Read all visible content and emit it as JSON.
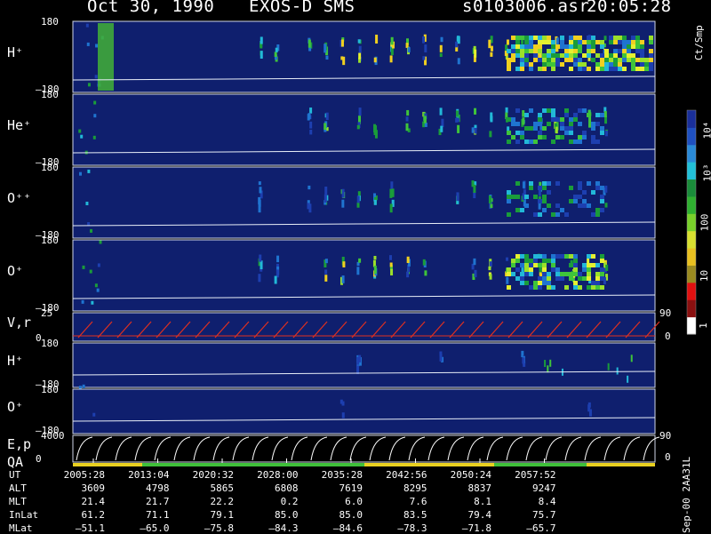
{
  "header": {
    "date": "Oct 30, 1990",
    "instrument": "EXOS-D SMS",
    "file": "s0103006.asr",
    "time": "20:05:28"
  },
  "colorbar": {
    "unit": "Ct/Smp",
    "ticks": [
      "10⁴",
      "10³",
      "100",
      "10",
      "1"
    ]
  },
  "panels": [
    {
      "label": "H⁺",
      "top": "180",
      "bottom": "–180"
    },
    {
      "label": "He⁺",
      "top": "180",
      "bottom": "–180"
    },
    {
      "label": "O⁺⁺",
      "top": "180",
      "bottom": "–180"
    },
    {
      "label": "O⁺",
      "top": "180",
      "bottom": "–180"
    },
    {
      "label": "V,r",
      "top": "25",
      "bottom": "0",
      "right_top": "90",
      "right_bottom": "0"
    },
    {
      "label": "H⁺",
      "top": "180",
      "bottom": "–180"
    },
    {
      "label": "O⁺",
      "top": "180",
      "bottom": "–180"
    },
    {
      "label": "E,p",
      "label2": "QA",
      "top": "4000",
      "bottom": "0",
      "right_top": "90",
      "right_bottom": "0"
    }
  ],
  "table": {
    "row_labels": [
      "UT",
      "ALT",
      "MLT",
      "InLat",
      "MLat"
    ],
    "columns": [
      [
        "2005:28",
        "3609",
        "21.4",
        "61.2",
        "–51.1"
      ],
      [
        "2013:04",
        "4798",
        "21.7",
        "71.1",
        "–65.0"
      ],
      [
        "2020:32",
        "5865",
        "22.2",
        "79.1",
        "–75.8"
      ],
      [
        "2028:00",
        "6808",
        "0.2",
        "85.0",
        "–84.3"
      ],
      [
        "2035:28",
        "7619",
        "6.0",
        "85.0",
        "–84.6"
      ],
      [
        "2042:56",
        "8295",
        "7.6",
        "83.5",
        "–78.3"
      ],
      [
        "2050:24",
        "8837",
        "8.1",
        "79.4",
        "–71.8"
      ],
      [
        "2057:52",
        "9247",
        "8.4",
        "75.7",
        "–65.7"
      ]
    ]
  },
  "footer": "Sep-00 2AA31L",
  "chart_data": {
    "type": "heatmap",
    "title": "Oct 30, 1990  EXOS-D SMS",
    "xlabel": "UT",
    "x_ticks": [
      "2005:28",
      "2013:04",
      "2020:32",
      "2028:00",
      "2035:28",
      "2042:56",
      "2050:24",
      "2057:52"
    ],
    "panels": [
      "H⁺",
      "He⁺",
      "O⁺⁺",
      "O⁺",
      "V,r",
      "H⁺",
      "O⁺",
      "E,p"
    ],
    "colorbar_unit": "Ct/Smp",
    "colorbar_range": [
      1,
      10000
    ],
    "colorbar_scale": "log"
  }
}
